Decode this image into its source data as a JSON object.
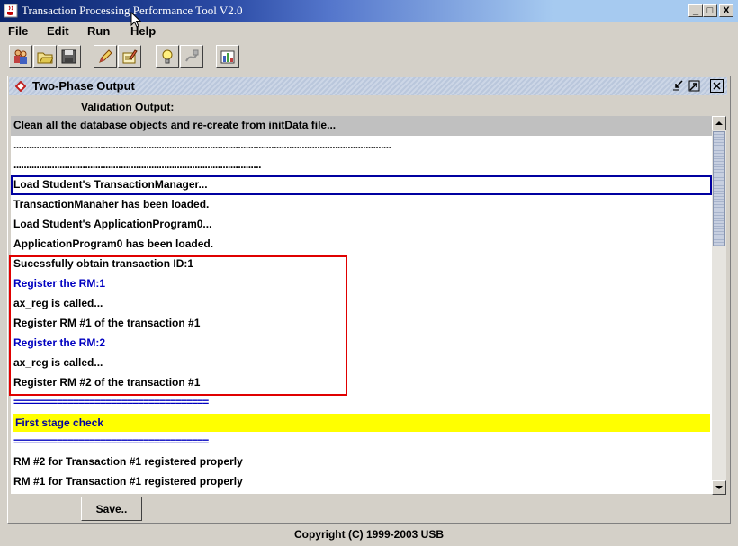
{
  "window": {
    "title": "Transaction Processing Performance Tool V2.0",
    "buttons": {
      "minimize": "_",
      "maximize": "□",
      "close": "X"
    }
  },
  "menu": [
    {
      "label": "File"
    },
    {
      "label": "Edit"
    },
    {
      "label": "Run"
    },
    {
      "label": "Help"
    }
  ],
  "toolbar": {
    "icons": [
      "users-icon",
      "open-folder-icon",
      "save-disk-icon",
      "edit-pencil-icon",
      "notepad-write-icon",
      "lightbulb-icon",
      "plug-icon",
      "chart-report-icon"
    ]
  },
  "frame": {
    "title": "Two-Phase Output",
    "validation_label": "Validation Output:"
  },
  "log": [
    {
      "text": "Clean all the database objects and re-create from initData file...",
      "style": "gray"
    },
    {
      "text": "....................................................................................................................................................",
      "style": "dots"
    },
    {
      "text": ".................................................................................................",
      "style": "dots"
    },
    {
      "text": "Load Student's TransactionManager...",
      "style": "sel"
    },
    {
      "text": "TransactionManaher has been loaded.",
      "style": ""
    },
    {
      "text": "Load Student's ApplicationProgram0...",
      "style": ""
    },
    {
      "text": "ApplicationProgram0 has been loaded.",
      "style": ""
    },
    {
      "text": "Sucessfully obtain transaction ID:1",
      "style": ""
    },
    {
      "text": "Register the RM:1",
      "style": "blue"
    },
    {
      "text": "ax_reg is called...",
      "style": ""
    },
    {
      "text": "Register RM #1 of the transaction #1",
      "style": ""
    },
    {
      "text": "Register the RM:2",
      "style": "blue"
    },
    {
      "text": "ax_reg is called...",
      "style": ""
    },
    {
      "text": "Register RM #2 of the transaction #1",
      "style": ""
    },
    {
      "text": "====================================",
      "style": "sep"
    },
    {
      "text": "First stage check",
      "style": "yellow"
    },
    {
      "text": "====================================",
      "style": "sep"
    },
    {
      "text": "RM #2 for Transaction #1 registered properly",
      "style": ""
    },
    {
      "text": "RM #1 for Transaction #1 registered properly",
      "style": ""
    }
  ],
  "save_button": "Save..",
  "copyright": "Copyright (C) 1999-2003 USB",
  "colors": {
    "highlight_red": "#e00000",
    "selection_blue": "#0000a0",
    "check_yellow": "#ffff00"
  }
}
